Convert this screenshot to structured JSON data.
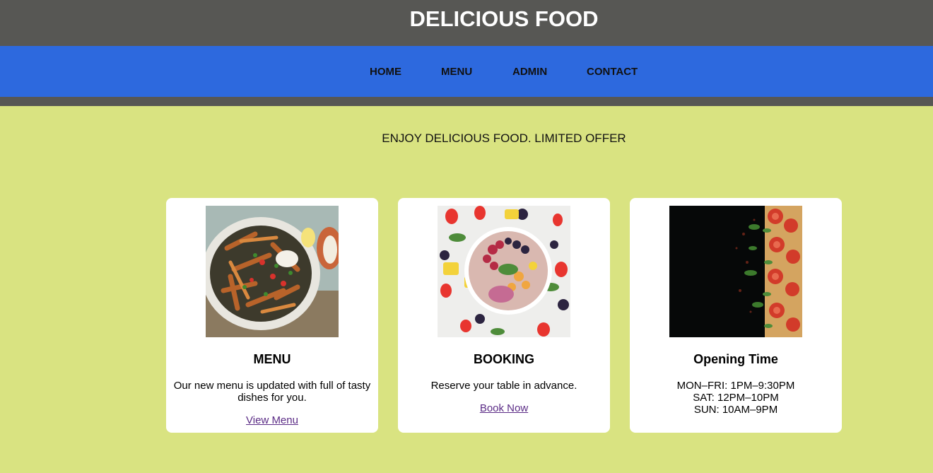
{
  "header": {
    "title": "DELICIOUS FOOD"
  },
  "nav": {
    "items": [
      {
        "label": "HOME"
      },
      {
        "label": "MENU"
      },
      {
        "label": "ADMIN"
      },
      {
        "label": "CONTACT"
      }
    ]
  },
  "hero": {
    "tagline": "ENJOY DELICIOUS FOOD. LIMITED OFFER"
  },
  "cards": [
    {
      "title": "MENU",
      "text": "Our new menu is updated with full of tasty dishes for you.",
      "link": "View Menu",
      "image": "sweet-potato-fries-bowl"
    },
    {
      "title": "BOOKING",
      "text": "Reserve your table in advance.",
      "link": "Book Now",
      "image": "fruit-smoothie-bowl"
    },
    {
      "title": "Opening Time",
      "hours": [
        "MON–FRI: 1PM–9:30PM",
        "SAT: 12PM–10PM",
        "SUN: 10AM–9PM"
      ],
      "image": "pizza-dark-background"
    }
  ],
  "colors": {
    "header_bg": "#575754",
    "nav_bg": "#2d69de",
    "page_bg": "#d9e381",
    "card_bg": "#ffffff",
    "link": "#5b2c86"
  }
}
